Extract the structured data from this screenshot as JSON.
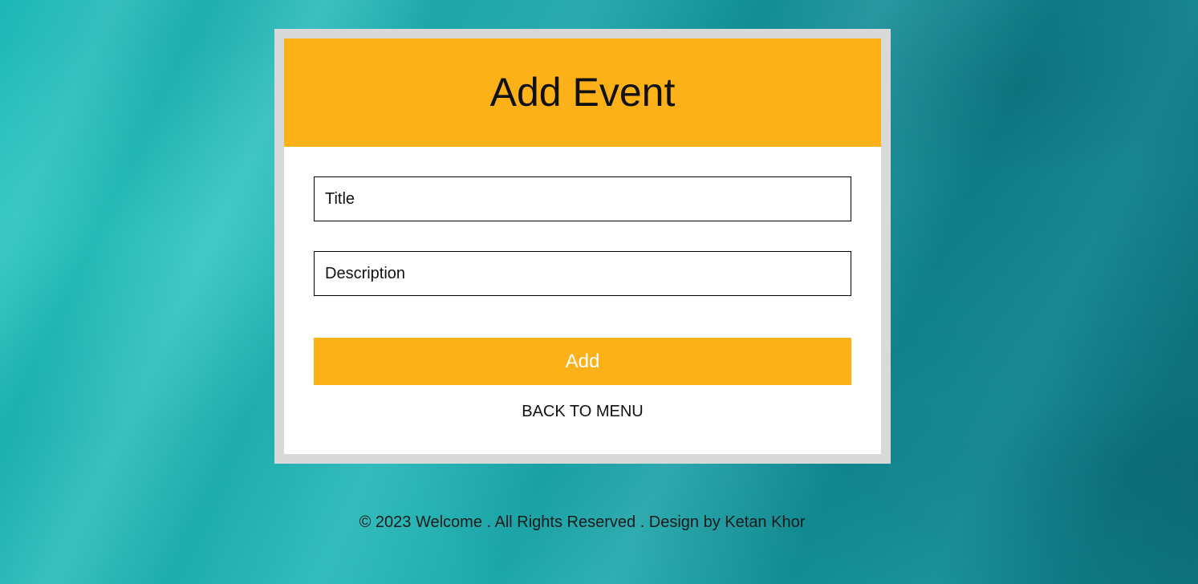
{
  "form": {
    "title": "Add Event",
    "fields": {
      "title_placeholder": "Title",
      "description_placeholder": "Description"
    },
    "add_label": "Add",
    "back_label": "BACK TO MENU"
  },
  "footer": {
    "text": "© 2023 Welcome . All Rights Reserved . Design by Ketan Khor"
  },
  "colors": {
    "accent": "#fdb119",
    "card_border": "#d9d9d9",
    "background": "#1cb8b6"
  }
}
